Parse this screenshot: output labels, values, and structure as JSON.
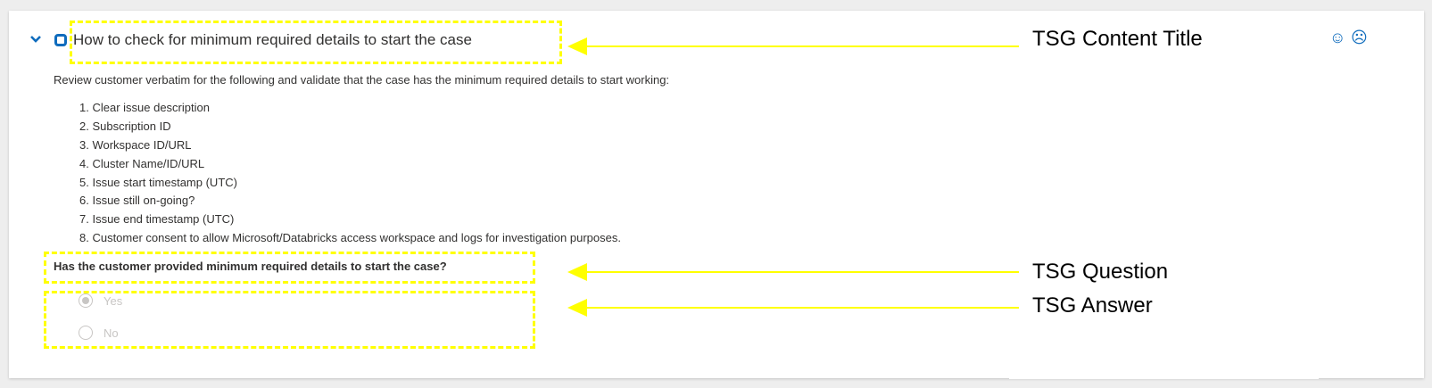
{
  "panel": {
    "title": "How to check for minimum required details to start the case",
    "intro": "Review customer verbatim for the following and validate that the case has the minimum required details to start working:",
    "steps": [
      "1. Clear issue description",
      "2. Subscription ID",
      "3. Workspace ID/URL",
      "4. Cluster Name/ID/URL",
      "5. Issue start timestamp (UTC)",
      "6. Issue still on-going?",
      "7. Issue end timestamp (UTC)",
      "8. Customer consent to allow Microsoft/Databricks access workspace and logs for investigation purposes."
    ],
    "question": "Has the customer provided minimum required details to start the case?",
    "answers": [
      {
        "label": "Yes",
        "selected": true
      },
      {
        "label": "No",
        "selected": false
      }
    ],
    "feedback": {
      "positive": "☺",
      "negative": "☹"
    }
  },
  "annotations": {
    "title_label": "TSG Content Title",
    "question_label": "TSG Question",
    "answer_label": "TSG Answer"
  },
  "colors": {
    "accent": "#0f6cbd",
    "highlight": "#ffff00",
    "disabled": "#c8c6c4"
  }
}
